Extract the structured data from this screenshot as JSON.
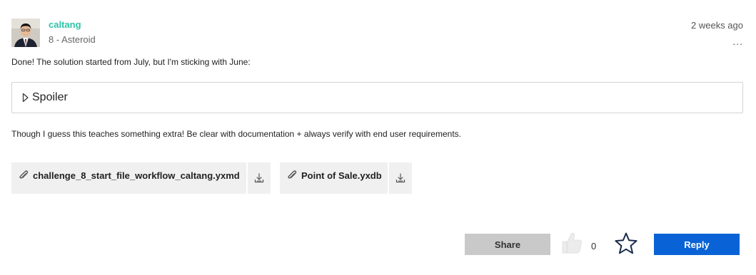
{
  "post": {
    "author": {
      "name": "caltang",
      "rank": "8 - Asteroid"
    },
    "timestamp": "2 weeks ago",
    "more_menu": "...",
    "body_text_1": "Done! The solution started from July, but I'm sticking with June:",
    "spoiler_label": "Spoiler",
    "body_text_2": "Though I guess this teaches something extra! Be clear with documentation + always verify with end user requirements.",
    "attachments": [
      {
        "name": "challenge_8_start_file_workflow_caltang.yxmd"
      },
      {
        "name": "Point of Sale.yxdb"
      }
    ]
  },
  "actions": {
    "share_label": "Share",
    "like_count": "0",
    "reply_label": "Reply"
  },
  "colors": {
    "author_link": "#2dc3a8",
    "reply_button": "#0a63d6",
    "share_button": "#c9c9c9",
    "attachment_bg": "#f0f0f0"
  },
  "icons": [
    "avatar-photo",
    "spoiler-arrow-icon",
    "paperclip-icon",
    "download-icon",
    "thumbs-up-icon",
    "star-icon"
  ]
}
